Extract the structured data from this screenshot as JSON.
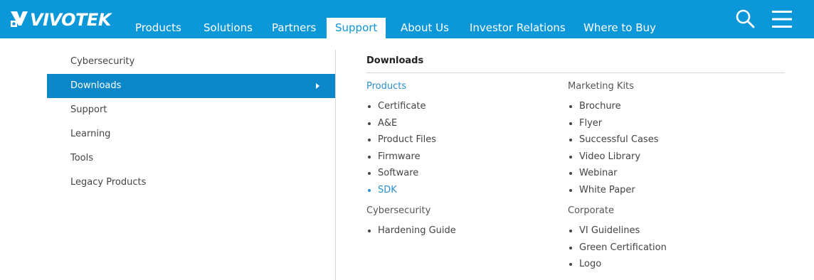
{
  "brand": {
    "logo_text": "VIVOTEK"
  },
  "nav": {
    "items": [
      {
        "label": "Products"
      },
      {
        "label": "Solutions"
      },
      {
        "label": "Partners"
      },
      {
        "label": "Support"
      },
      {
        "label": "About Us"
      },
      {
        "label": "Investor Relations"
      },
      {
        "label": "Where to Buy"
      }
    ],
    "active": "Support"
  },
  "sidebar": {
    "items": [
      {
        "label": "Cybersecurity"
      },
      {
        "label": "Downloads"
      },
      {
        "label": "Support"
      },
      {
        "label": "Learning"
      },
      {
        "label": "Tools"
      },
      {
        "label": "Legacy Products"
      }
    ],
    "active": "Downloads"
  },
  "panel": {
    "title": "Downloads",
    "products": {
      "heading": "Products",
      "items": [
        "Certificate",
        "A&E",
        "Product Files",
        "Firmware",
        "Software",
        "SDK"
      ]
    },
    "cybersecurity": {
      "heading": "Cybersecurity",
      "items": [
        "Hardening Guide"
      ]
    },
    "marketing": {
      "heading": "Marketing Kits",
      "items": [
        "Brochure",
        "Flyer",
        "Successful Cases",
        "Video Library",
        "Webinar",
        "White Paper"
      ]
    },
    "corporate": {
      "heading": "Corporate",
      "items": [
        "VI Guidelines",
        "Green Certification",
        "Logo"
      ]
    }
  },
  "colors": {
    "nav_bg": "#0b97d8",
    "active_side": "#0b86c8",
    "link": "#2a8fd0"
  }
}
